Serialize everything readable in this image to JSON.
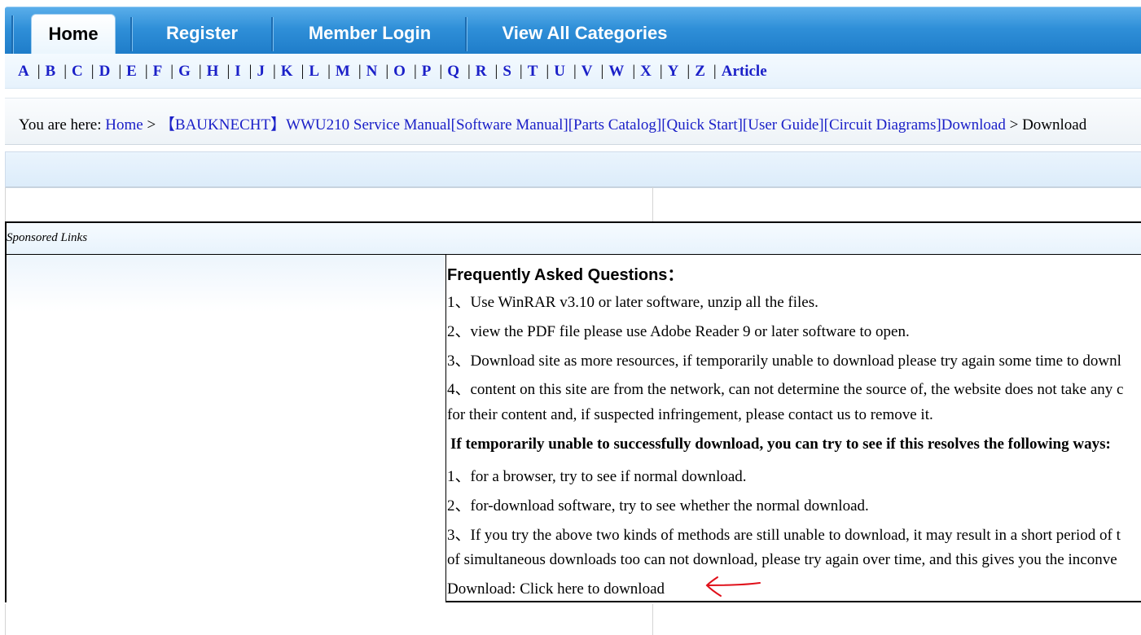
{
  "nav": {
    "tabs": [
      {
        "label": "Home",
        "active": true
      },
      {
        "label": "Register",
        "active": false
      },
      {
        "label": "Member Login",
        "active": false
      },
      {
        "label": "View All Categories",
        "active": false
      }
    ]
  },
  "letters": [
    "A",
    "B",
    "C",
    "D",
    "E",
    "F",
    "G",
    "H",
    "I",
    "J",
    "K",
    "L",
    "M",
    "N",
    "O",
    "P",
    "Q",
    "R",
    "S",
    "T",
    "U",
    "V",
    "W",
    "X",
    "Y",
    "Z",
    "Article"
  ],
  "breadcrumb": {
    "prefix": "You are here:",
    "home": "Home",
    "sep1": ">",
    "product": "【BAUKNECHT】WWU210 Service Manual[Software Manual][Parts Catalog][Quick Start][User Guide][Circuit Diagrams]Download",
    "sep2": ">",
    "current": "Download"
  },
  "sponsored_label": "Sponsored Links",
  "faq": {
    "title": "Frequently Asked Questions：",
    "lines": [
      {
        "text": "1、Use WinRAR v3.10 or later software, unzip all the files.",
        "bold": false
      },
      {
        "text": "2、view the PDF file please use Adobe Reader 9 or later software to open.",
        "bold": false
      },
      {
        "text": "3、Download site as more resources, if temporarily unable to download please try again some time to downl",
        "bold": false
      },
      {
        "text": "4、content on this site are from the network, can not determine the source of, the website does not take any c",
        "bold": false
      },
      {
        "text": "for their content and, if suspected infringement, please contact us to remove it.",
        "bold": false
      },
      {
        "text": "If temporarily unable to successfully download, you can try to see if this resolves the following ways:",
        "bold": true
      },
      {
        "text": "1、for a browser, try to see if normal download.",
        "bold": false
      },
      {
        "text": "2、for-download software, try to see whether the normal download.",
        "bold": false
      },
      {
        "text": "3、If you try the above two kinds of methods are still unable to download, it may result in a short period of t",
        "bold": false
      },
      {
        "text": "of simultaneous downloads too can not download, please try again over time, and this gives you the inconve",
        "bold": false
      }
    ],
    "download_prefix": "Download:",
    "download_link": "Click here to download"
  },
  "colors": {
    "link": "#1b20c8",
    "nav_blue": "#2f8fd8",
    "arrow": "#e0101a"
  },
  "icons": {
    "arrow": "red-arrow-left-icon"
  }
}
